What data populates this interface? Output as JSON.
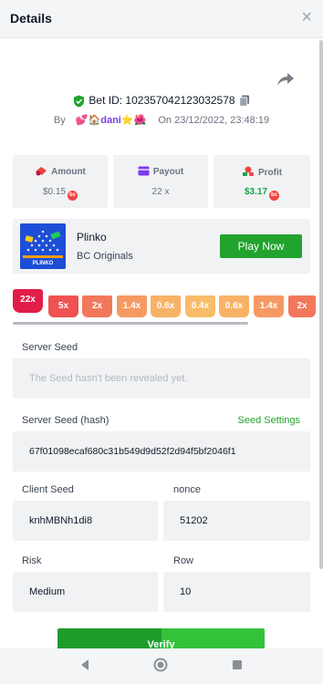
{
  "header": {
    "title": "Details",
    "close_glyph": "×"
  },
  "bet": {
    "id_text": "Bet ID: 102357042123032578",
    "by_label": "By",
    "username": "dani",
    "username_decor_left": "💕🏠",
    "username_decor_right": "⭐🌺",
    "on_label": "On",
    "datetime": "23/12/2022, 23:48:19"
  },
  "stats": [
    {
      "label": "Amount",
      "value": "$0.15",
      "icon": "amount-icon",
      "color": "#ef4444"
    },
    {
      "label": "Payout",
      "value": "22 x",
      "icon": "payout-icon",
      "color": "#7c3aed"
    },
    {
      "label": "Profit",
      "value": "$3.17",
      "icon": "profit-icon",
      "color": "#16a34a"
    }
  ],
  "game": {
    "name": "Plinko",
    "provider": "BC Originals",
    "play_label": "Play Now",
    "thumb_label": "PLINKO"
  },
  "multipliers": [
    {
      "label": "22x",
      "color": "#e11d48",
      "highlight": true
    },
    {
      "label": "5x",
      "color": "#f05252"
    },
    {
      "label": "2x",
      "color": "#f2785c"
    },
    {
      "label": "1.4x",
      "color": "#f59a62"
    },
    {
      "label": "0.6x",
      "color": "#f8b266"
    },
    {
      "label": "0.4x",
      "color": "#f9bc68"
    },
    {
      "label": "0.6x",
      "color": "#f8b266"
    },
    {
      "label": "1.4x",
      "color": "#f59a62"
    },
    {
      "label": "2x",
      "color": "#f2785c"
    }
  ],
  "server_seed": {
    "label": "Server Seed",
    "placeholder": "The Seed hasn't been revealed yet."
  },
  "server_seed_hash": {
    "label": "Server Seed (hash)",
    "link": "Seed Settings",
    "value": "67f01098ecaf680c31b549d9d52f2d94f5bf2046f1"
  },
  "client_seed": {
    "label": "Client Seed",
    "value": "knhMBNh1di8"
  },
  "nonce": {
    "label": "nonce",
    "value": "51202"
  },
  "risk": {
    "label": "Risk",
    "value": "Medium"
  },
  "row": {
    "label": "Row",
    "value": "10"
  },
  "verify": {
    "label": "Verify"
  },
  "colors": {
    "accent_green": "#22a32d",
    "panel_bg": "#f1f2f4"
  }
}
